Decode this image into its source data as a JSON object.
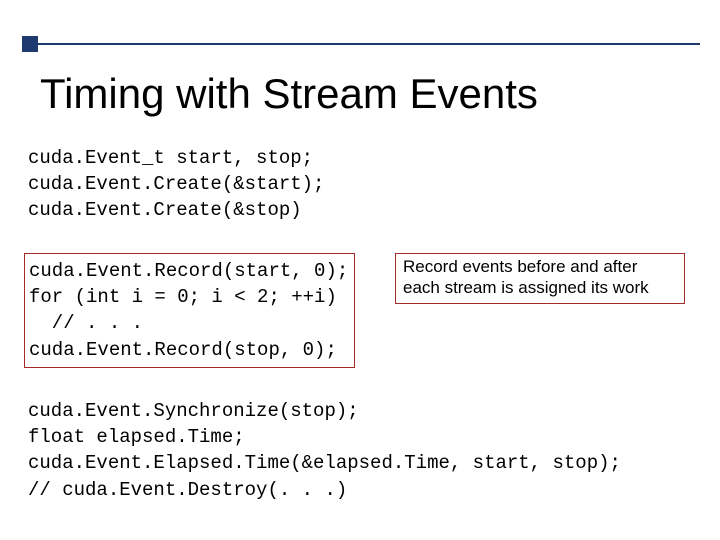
{
  "title": "Timing with Stream Events",
  "code_top": "cuda.Event_t start, stop;\ncuda.Event.Create(&start);\ncuda.Event.Create(&stop)",
  "code_boxed": "cuda.Event.Record(start, 0);\nfor (int i = 0; i < 2; ++i)\n  // . . .\ncuda.Event.Record(stop, 0);",
  "annotation": "Record events before and after each stream is assigned its work",
  "code_bottom": "cuda.Event.Synchronize(stop);\nfloat elapsed.Time;\ncuda.Event.Elapsed.Time(&elapsed.Time, start, stop);\n// cuda.Event.Destroy(. . .)"
}
